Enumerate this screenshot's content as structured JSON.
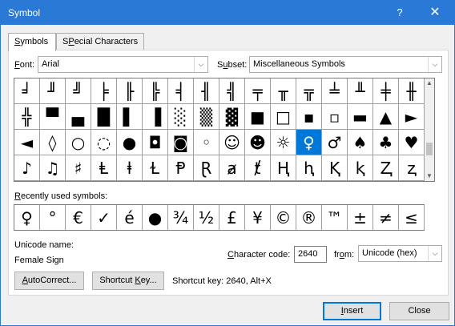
{
  "window": {
    "title": "Symbol",
    "help_glyph": "?",
    "close_glyph": "✕"
  },
  "tabs": [
    {
      "label": "Symbols",
      "mnemonic": "S",
      "rest": "ymbols"
    },
    {
      "label": "Special Characters",
      "mnemonic": "P",
      "before": "S",
      "rest": "ecial Characters"
    }
  ],
  "font": {
    "label_mn": "F",
    "label_rest": "ont:",
    "value": "Arial"
  },
  "subset": {
    "label_before": "S",
    "label_mn": "u",
    "label_rest": "bset:",
    "value": "Miscellaneous Symbols"
  },
  "symbols": [
    [
      "╛",
      "╜",
      "╝",
      "╞",
      "╟",
      "╠",
      "╡",
      "╢",
      "╣",
      "╤",
      "╥",
      "╦",
      "╧",
      "╨",
      "╪",
      "╫"
    ],
    [
      "╬",
      "▀",
      "▄",
      "█",
      "▌",
      "▐",
      "░",
      "▒",
      "▓",
      "■",
      "□",
      "▪",
      "▫",
      "▬",
      "▲",
      "►"
    ],
    [
      "◄",
      "◊",
      "○",
      "◌",
      "●",
      "◘",
      "◙",
      "◦",
      "☺",
      "☻",
      "☼",
      "♀",
      "♂",
      "♠",
      "♣",
      "♥"
    ],
    [
      "♪",
      "♫",
      "♯",
      "Ⱡ",
      "ⱡ",
      "Ɫ",
      "Ᵽ",
      "Ɽ",
      "ⱥ",
      "ⱦ",
      "Ⱨ",
      "ⱨ",
      "Ⱪ",
      "ⱪ",
      "Ⱬ",
      "ⱬ"
    ]
  ],
  "selected_symbol": "♀",
  "recent": {
    "label_before": "",
    "label_mn": "R",
    "label_rest": "ecently used symbols:",
    "symbols": [
      "♀",
      "°",
      "€",
      "✓",
      "é",
      "●",
      "¾",
      "½",
      "£",
      "¥",
      "©",
      "®",
      "™",
      "±",
      "≠",
      "≤",
      "≥"
    ]
  },
  "unicode": {
    "name_label": "Unicode name:",
    "name_value": "Female Sign"
  },
  "charcode": {
    "label_mn": "C",
    "label_rest": "haracter code:",
    "value": "2640"
  },
  "from": {
    "label_before": "fr",
    "label_mn": "o",
    "label_rest": "m:",
    "value": "Unicode (hex)"
  },
  "buttons": {
    "autocorrect": {
      "mn": "A",
      "rest": "utoCorrect..."
    },
    "shortcut": {
      "before": "Shortcut ",
      "mn": "K",
      "rest": "ey..."
    },
    "insert": {
      "mn": "I",
      "rest": "nsert"
    },
    "close": "Close"
  },
  "shortcut_text": "Shortcut key: 2640, Alt+X",
  "dropdown_glyph": "⌵",
  "scroll_up_glyph": "▲",
  "scroll_down_glyph": "▼"
}
